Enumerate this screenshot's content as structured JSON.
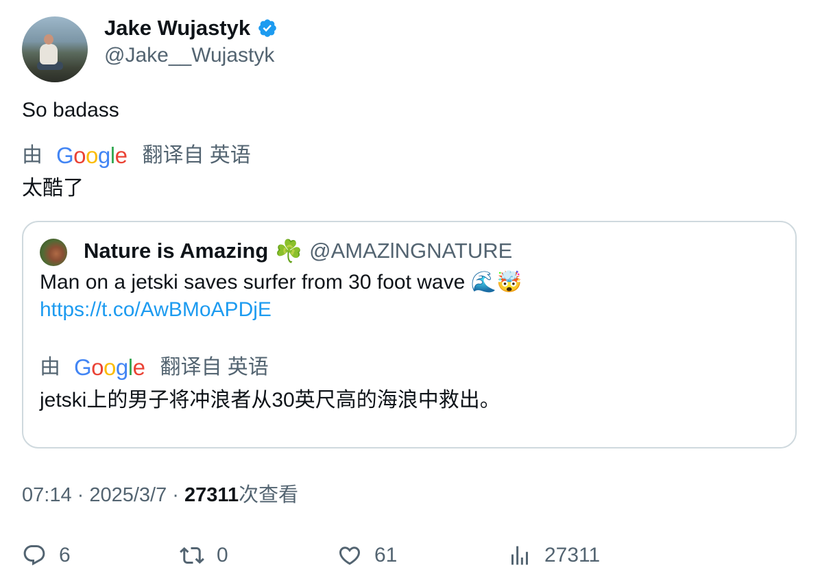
{
  "author": {
    "display_name": "Jake Wujastyk",
    "handle": "@Jake__Wujastyk",
    "verified": true
  },
  "tweet": {
    "text": "So badass",
    "translated_by_prefix": "由",
    "translated_by_suffix": "翻译自 英语",
    "translation": "太酷了"
  },
  "quote": {
    "display_name": "Nature is Amazing",
    "emoji": "☘️",
    "handle": "@AMAZlNGNATURE",
    "text": "Man on a jetski saves surfer from 30 foot wave 🌊🤯",
    "link": "https://t.co/AwBMoAPDjE",
    "translated_by_prefix": "由",
    "translated_by_suffix": "翻译自 英语",
    "translation": "jetski上的男子将冲浪者从30英尺高的海浪中救出。"
  },
  "meta": {
    "time": "07:14",
    "sep1": " · ",
    "date": "2025/3/7",
    "sep2": " · ",
    "views_count": "27311",
    "views_label": "次查看"
  },
  "actions": {
    "replies": "6",
    "retweets": "0",
    "likes": "61",
    "views": "27311"
  },
  "colors": {
    "primary_text": "#0f1419",
    "secondary_text": "#536471",
    "link": "#1d9bf0",
    "border": "#cfd9de",
    "verified": "#1d9bf0"
  }
}
